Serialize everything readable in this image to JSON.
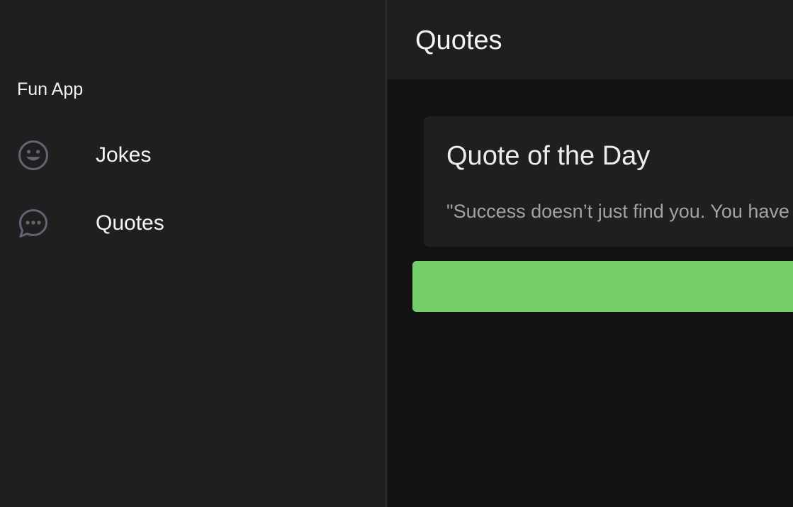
{
  "sidebar": {
    "app_title": "Fun App",
    "items": [
      {
        "label": "Jokes",
        "icon": "smiley-face-icon"
      },
      {
        "label": "Quotes",
        "icon": "chat-bubble-icon"
      }
    ]
  },
  "header": {
    "title": "Quotes"
  },
  "card": {
    "title": "Quote of the Day",
    "quote": "\"Success doesn’t just find you. You have"
  },
  "colors": {
    "sidebar_bg": "#1f1f1f",
    "main_bg": "#121212",
    "accent_green": "#75d06b",
    "icon_gray": "#5f6670"
  }
}
